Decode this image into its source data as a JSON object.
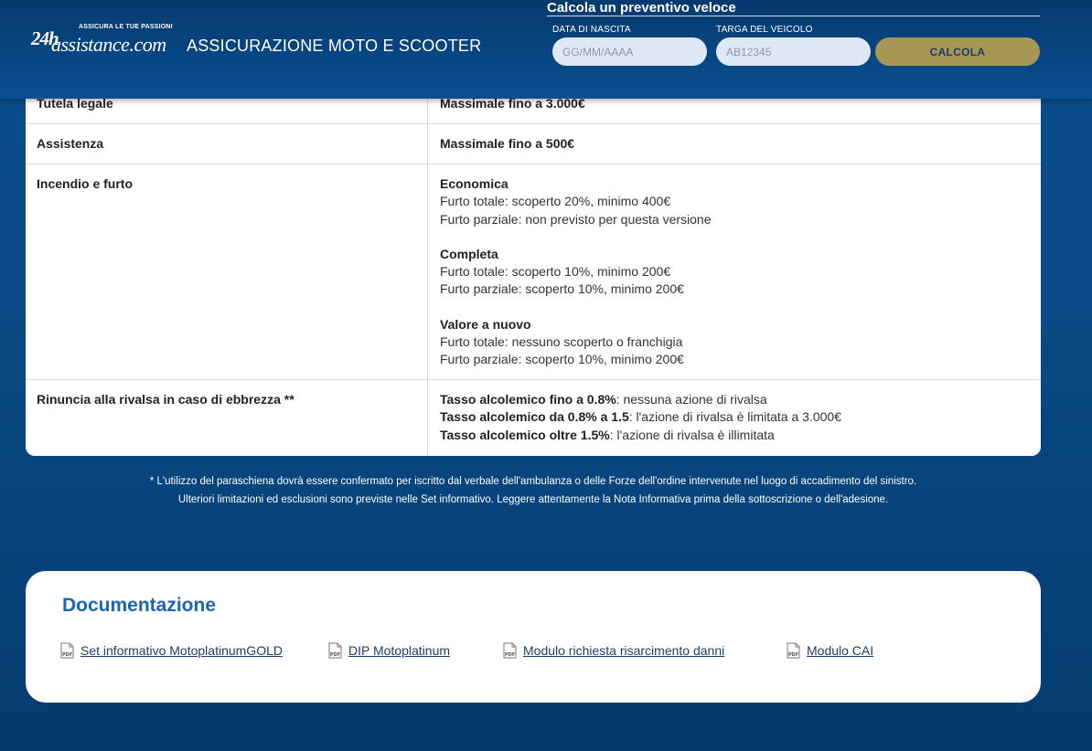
{
  "header": {
    "logo": {
      "number": "24h",
      "brand": "assistance.com",
      "tagline": "ASSICURA LE TUE PASSIONI"
    },
    "page_heading": "ASSICURAZIONE MOTO E SCOOTER"
  },
  "quote_form": {
    "title": "Calcola un preventivo veloce",
    "birth_date": {
      "label": "DATA DI NASCITA",
      "placeholder": "GG/MM/AAAA",
      "value": ""
    },
    "plate": {
      "label": "TARGA DEL VEICOLO",
      "placeholder": "AB12345",
      "value": ""
    },
    "submit_label": "CALCOLA"
  },
  "coverage_rows": [
    {
      "name": "Tutela legale",
      "detail": "Massimale fino a 3.000€"
    },
    {
      "name": "Assistenza",
      "detail": "Massimale fino a 500€"
    },
    {
      "name": "Incendio e furto",
      "options": [
        {
          "title": "Economica",
          "lines": [
            "Furto totale: scoperto 20%, minimo 400€",
            "Furto parziale: non previsto per questa versione"
          ]
        },
        {
          "title": "Completa",
          "lines": [
            "Furto totale: scoperto 10%, minimo 200€",
            "Furto parziale: scoperto 10%, minimo 200€"
          ]
        },
        {
          "title": "Valore a nuovo",
          "lines": [
            "Furto totale: nessuno scoperto o franchigia",
            "Furto parziale: scoperto 10%, minimo 200€"
          ]
        }
      ]
    },
    {
      "name": "Rinuncia alla rivalsa in caso di ebbrezza **",
      "items": [
        {
          "bold": "Tasso alcolemico fino a 0.8%",
          "text": ": nessuna azione di rivalsa"
        },
        {
          "bold": "Tasso alcolemico da 0.8% a 1.5",
          "text": ": l'azione di rivalsa è limitata a 3.000€"
        },
        {
          "bold": "Tasso alcolemico oltre 1.5%",
          "text": ": l'azione di rivalsa è illimitata"
        }
      ]
    }
  ],
  "footnotes": [
    "* L'utilizzo del paraschiena dovrà essere confermato per iscritto dal verbale dell'ambulanza o delle Forze dell'ordine intervenute nel luogo di accadimento del sinistro.",
    "Ulteriori limitazioni ed esclusioni sono previste nelle Set informativo. Leggere attentamente la Nota Informativa prima della sottoscrizione o dell'adesione."
  ],
  "documentation": {
    "title": "Documentazione",
    "icon": "pdf-file-icon",
    "links": [
      "Set informativo MotoplatinumGOLD",
      "DIP Motoplatinum",
      "Modulo richiesta risarcimento danni",
      "Modulo CAI"
    ]
  },
  "colors": {
    "header_bg": "#0a4f93",
    "page_bg": "#0a4c8c",
    "calc_button": "#a79754",
    "doc_title": "#1a66b4"
  }
}
